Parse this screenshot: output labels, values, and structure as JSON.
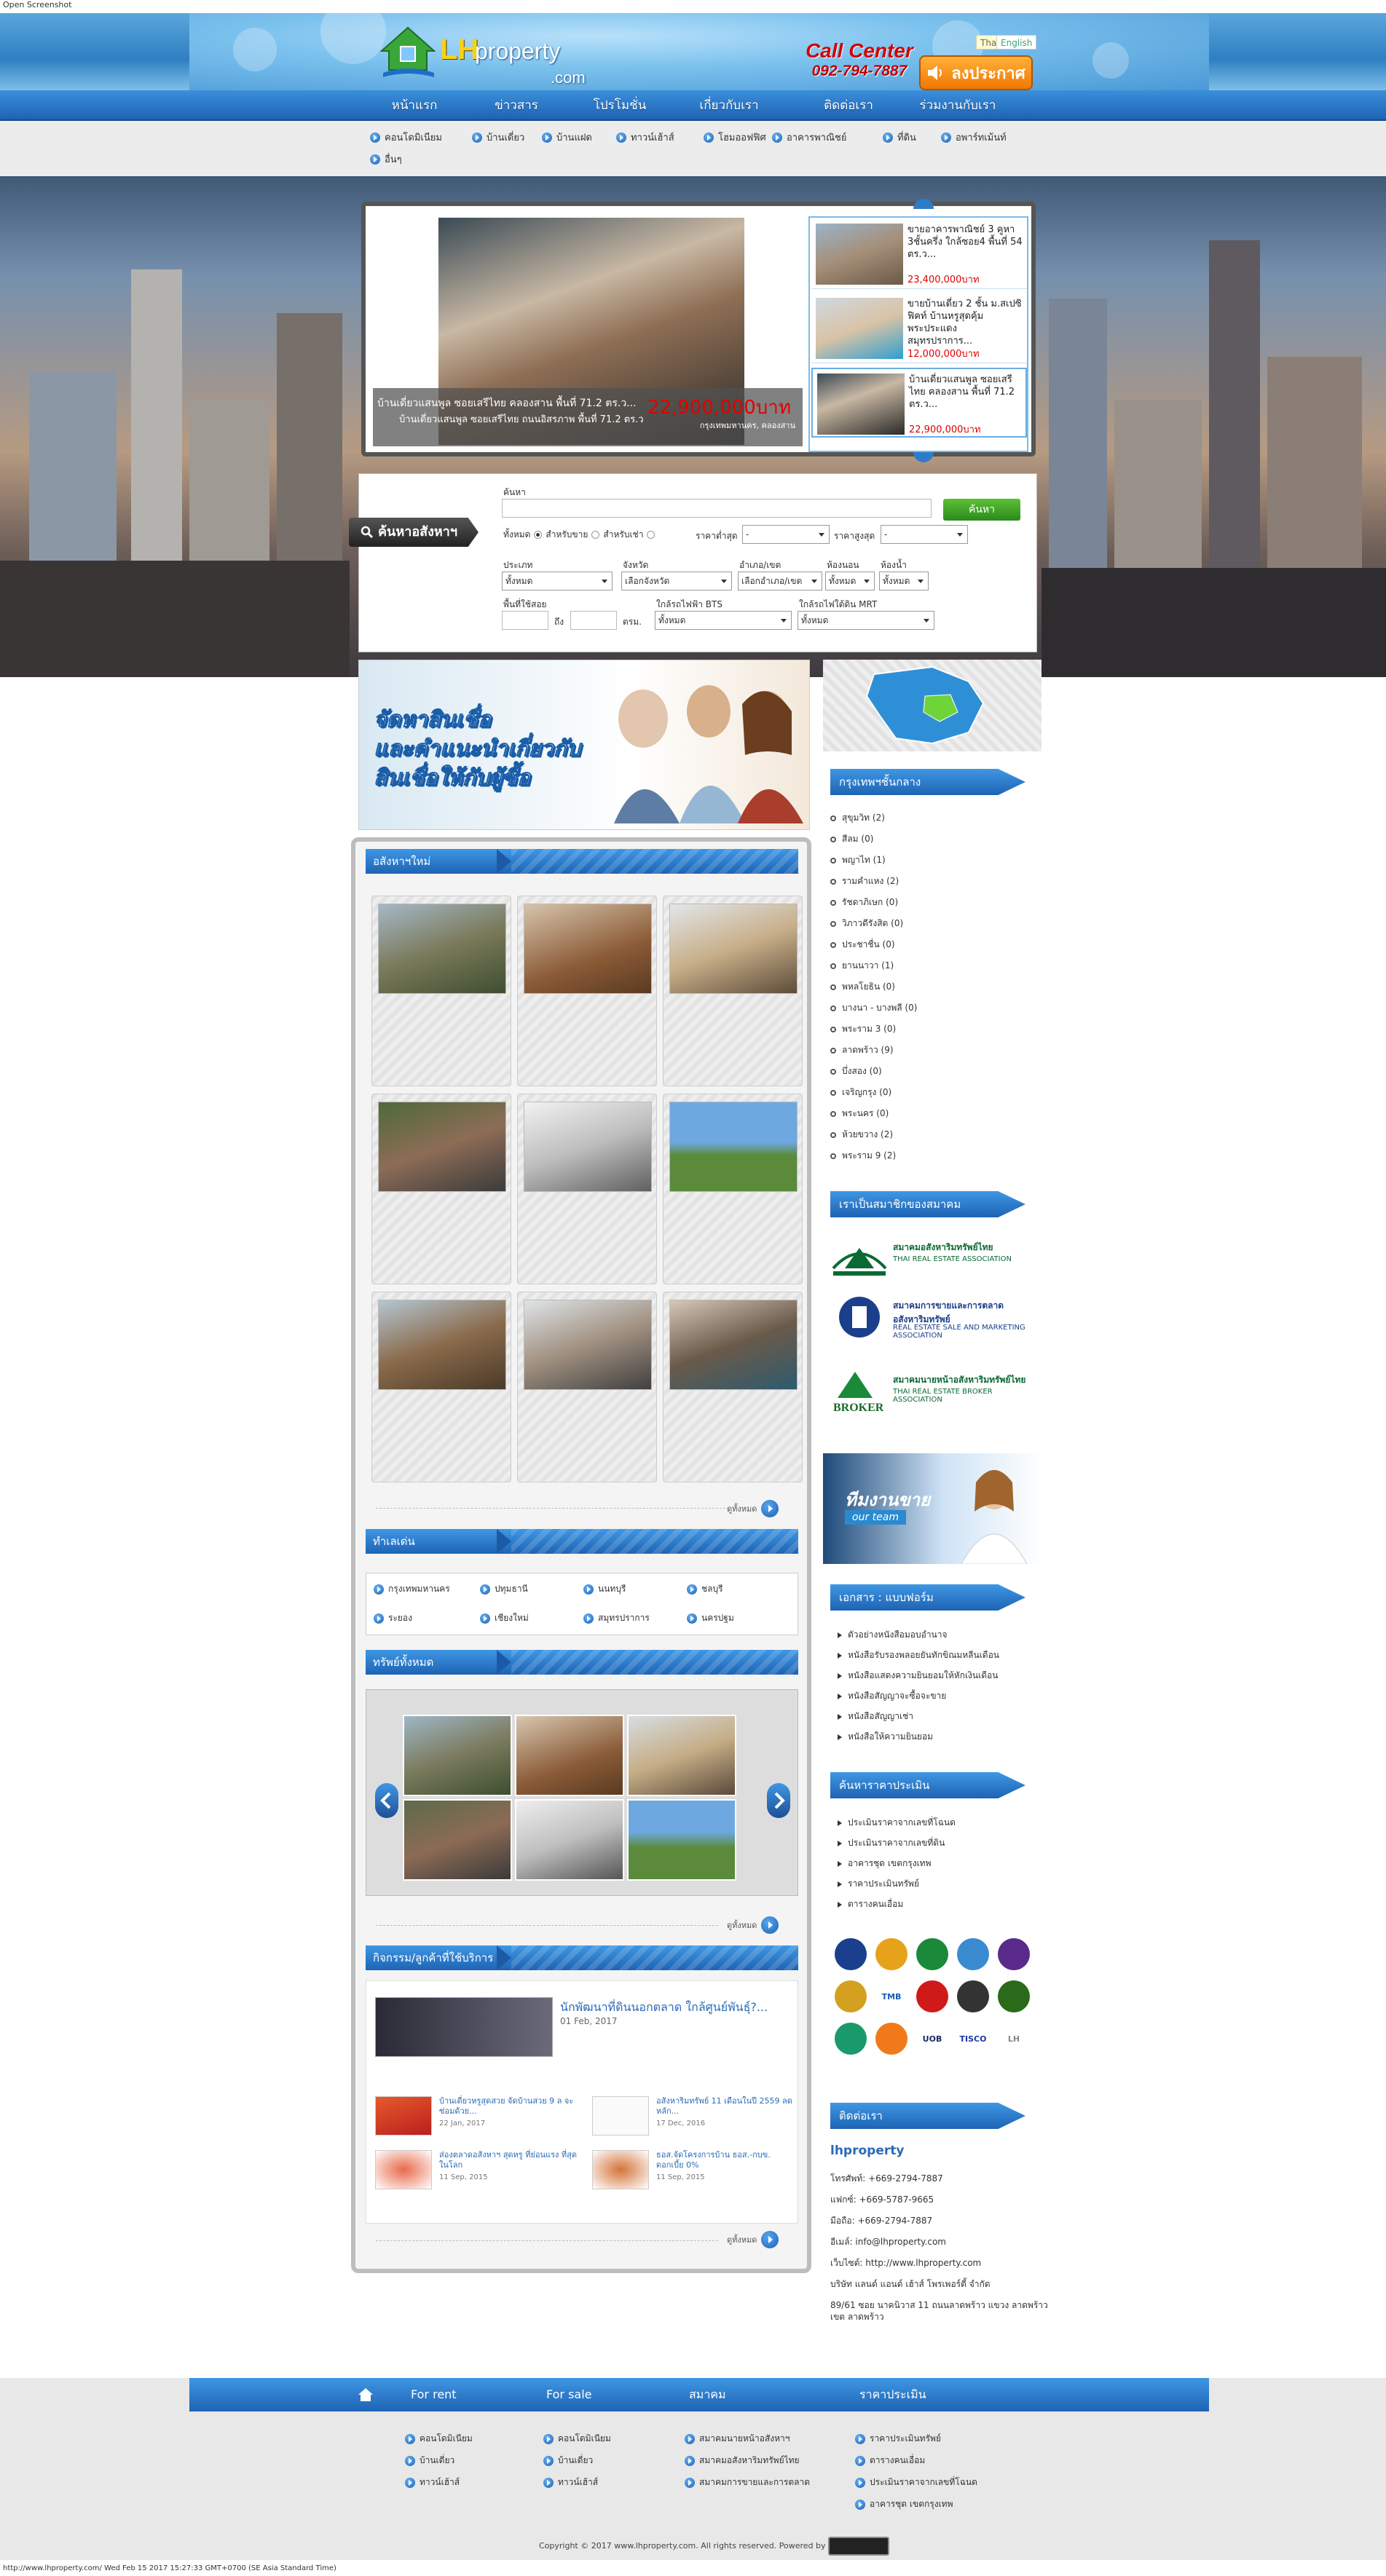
{
  "window": {
    "title": "Open Screenshot",
    "status": "http://www.lhproperty.com/ Wed Feb 15 2017 15:27:33 GMT+0700 (SE Asia Standard Time)"
  },
  "header": {
    "logo_lh": "LH",
    "logo_property": "property",
    "logo_com": ".com",
    "call_center": "Call Center",
    "phone": "092-794-7887",
    "announce": "ลงประกาศ",
    "lang_thai": "Thai",
    "lang_english": "English"
  },
  "nav": [
    "หน้าแรก",
    "ข่าวสาร",
    "โปรโมชั่น",
    "เกี่ยวกับเรา",
    "ติดต่อเรา",
    "ร่วมงานกับเรา"
  ],
  "subnav": [
    "คอนโดมิเนียม",
    "บ้านเดี่ยว",
    "บ้านแฝด",
    "ทาวน์เฮ้าส์",
    "โฮมออฟฟิศ",
    "อาคารพาณิชย์",
    "ที่ดิน",
    "อพาร์ทเม้นท์",
    "อื่นๆ"
  ],
  "slider": {
    "main_title": "บ้านเดี่ยวแสนพูล ซอยเสรีไทย คลองสาน พื้นที่ 71.2 ตร.ว...",
    "main_subtitle": "บ้านเดี่ยวแสนพูล ซอยเสรีไทย ถนนอิสรภาพ พื้นที่ 71.2 ตร.ว",
    "main_price": "22,900,000บาท",
    "main_location": "กรุงเทพมหานคร, คลองสาน",
    "items": [
      {
        "title": "ขายอาคารพาณิชย์ 3 คูหา 3ชั้นครึ่ง ใกล้ซอย4 พื้นที่ 54 ตร.ว...",
        "price": "23,400,000บาท"
      },
      {
        "title": "ขายบ้านเดี่ยว 2 ชั้น ม.สเปซิฟิคท์ บ้านหรูสุดคุ้ม พระประแดง สมุทรปราการ...",
        "price": "12,000,000บาท"
      },
      {
        "title": "บ้านเดี่ยวแสนพูล ซอยเสรีไทย คลองสาน พื้นที่ 71.2 ตร.ว...",
        "price": "22,900,000บาท"
      }
    ]
  },
  "search": {
    "tag": "ค้นหาอสังหาฯ",
    "keyword_label": "ค้นหา",
    "button": "ค้นหา",
    "type_label": "ประเภท",
    "type_options": [
      "ทั้งหมด",
      "สำหรับขาย",
      "สำหรับเช่า"
    ],
    "price_min_label": "ราคาต่ำสุด",
    "price_max_label": "ราคาสูงสุด",
    "price_min_value": "-",
    "price_max_value": "-",
    "category_label": "ประเภท",
    "category_value": "ทั้งหมด",
    "province_label": "จังหวัด",
    "province_value": "เลือกจังหวัด",
    "district_label": "อำเภอ/เขต",
    "district_value": "เลือกอำเภอ/เขต",
    "bedroom_label": "ห้องนอน",
    "bedroom_value": "ทั้งหมด",
    "bathroom_label": "ห้องน้ำ",
    "bathroom_value": "ทั้งหมด",
    "area_label": "พื้นที่ใช้สอย",
    "area_to": "ถึง",
    "area_unit": "ตรม.",
    "bts_label": "ใกล้รถไฟฟ้า BTS",
    "bts_value": "ทั้งหมด",
    "mrt_label": "ใกล้รถไฟใต้ดิน MRT",
    "mrt_value": "ทั้งหมด"
  },
  "banner": {
    "line1": "จัดหาสินเชื่อ",
    "line2": "และคำแนะนำเกี่ยวกับ",
    "line3": "สินเชื่อให้กับผู้ซื้อ"
  },
  "sections": {
    "new_property": "อสังหาฯใหม่",
    "popular": "ทำเลเด่น",
    "all_property": "ทรัพย์ทั้งหมด",
    "activity": "กิจกรรม/ลูกค้าที่ใช้บริการ",
    "see_all": "ดูทั้งหมด"
  },
  "provinces": [
    "กรุงเทพมหานคร",
    "ปทุมธานี",
    "นนทบุรี",
    "ชลบุรี",
    "ระยอง",
    "เชียงใหม่",
    "สมุทรปราการ",
    "นครปฐม"
  ],
  "activity": {
    "main_title": "นักพัฒนาที่ดินนอกตลาด ใกล้ศูนย์พันธุ์?...",
    "main_date": "01 Feb, 2017",
    "items": [
      {
        "title": "บ้านเดี่ยวหรูสุดสวย จัดบ้านสวย 9 ล จะซ่อมด้วย...",
        "date": "22 Jan, 2017"
      },
      {
        "title": "อสังหาริมทรัพย์ 11 เดือนในปี 2559 ลดหลัก...",
        "date": "17 Dec, 2016"
      },
      {
        "title": "ส่องตลาดอสังหาฯ สุดหรู ที่ย่อนแรง ที่สุดในโลก",
        "date": "11 Sep, 2015"
      },
      {
        "title": "ธอส.จัดโครงการบ้าน ธอส.-กบข. ดอกเบี้ย 0%",
        "date": "11 Sep, 2015"
      }
    ]
  },
  "right": {
    "bkk_title": "กรุงเทพฯชั้นกลาง",
    "bkk_items": [
      "สุขุมวิท (2)",
      "สีลม (0)",
      "พญาไท (1)",
      "รามคำแหง (2)",
      "รัชดาภิเษก (0)",
      "วิภาวดีรังสิต (0)",
      "ประชาชื่น (0)",
      "ยานนาวา (1)",
      "พหลโยธิน (0)",
      "บางนา - บางพลี (0)",
      "พระราม 3 (0)",
      "ลาดพร้าว (9)",
      "บึ่งสอง (0)",
      "เจริญกรุง (0)",
      "พระนคร (0)",
      "ห้วยขวาง (2)",
      "พระราม 9 (2)"
    ],
    "member_title": "เราเป็นสมาชิกของสมาคม",
    "assoc": [
      {
        "name": "สมาคมอสังหาริมทรัพย์ไทย",
        "en": "THAI REAL ESTATE ASSOCIATION"
      },
      {
        "name": "สมาคมการขายและการตลาด อสังหาริมทรัพย์",
        "en": "REAL ESTATE SALE AND MARKETING ASSOCIATION"
      },
      {
        "name": "สมาคมนายหน้าอสังหาริมทรัพย์ไทย",
        "en": "THAI REAL ESTATE BROKER ASSOCIATION"
      }
    ],
    "team_label": "ทีมงานขาย",
    "team_sub": "our team",
    "docs_title": "เอกสาร : แบบฟอร์ม",
    "docs": [
      "ตัวอย่างหนังสือมอบอำนาจ",
      "หนังสือรับรองพลอยยันทักขิณมหลีนเดือน",
      "หนังสือแสดงความยินยอมให้หักเงินเดือน",
      "หนังสือสัญญาจะซื้อจะขาย",
      "หนังสือสัญญาเช่า",
      "หนังสือให้ความยินยอม"
    ],
    "price_title": "ค้นหาราคาประเมิน",
    "price_links": [
      "ประเมินราคาจากเลขที่โฉนด",
      "ประเมินราคาจากเลขที่ดิน",
      "อาคารชุด เขตกรุงเทพ",
      "ราคาประเมินทรัพย์",
      "ตารางคนเอื่อม"
    ],
    "contact_title": "ติดต่อเรา",
    "contact_name": "lhproperty",
    "contact_lines": [
      "โทรศัพท์: +669-2794-7887",
      "แฟกซ์: +669-5787-9665",
      "มือถือ: +669-2794-7887",
      "อีเมล์: info@lhproperty.com",
      "เว็บไซต์: http://www.lhproperty.com",
      "บริษัท แลนด์ แอนด์ เฮ้าส์ โพรเพอร์ตี้ จำกัด",
      "89/61 ซอย นาคนิวาส 11 ถนนลาดพร้าว แขวง ลาดพร้าว เขต ลาดพร้าว"
    ]
  },
  "banks": [
    "bank-icon-1",
    "bank-icon-2",
    "bank-icon-3",
    "bank-icon-4",
    "bank-icon-5",
    "bank-icon-6",
    "bank-icon-tmb",
    "bank-icon-8",
    "bank-icon-9",
    "bank-icon-10",
    "bank-icon-11",
    "bank-icon-12",
    "bank-icon-uob",
    "bank-icon-tisco",
    "bank-icon-lh"
  ],
  "bank_labels": {
    "tmb": "TMB",
    "uob": "UOB",
    "tisco": "TISCO",
    "lh": "LH"
  },
  "footer": {
    "bar": [
      "For rent",
      "For sale",
      "สมาคม",
      "ราคาประเมิน"
    ],
    "rent": [
      "คอนโดมิเนียม",
      "บ้านเดี่ยว",
      "ทาวน์เฮ้าส์"
    ],
    "sale": [
      "คอนโดมิเนียม",
      "บ้านเดี่ยว",
      "ทาวน์เฮ้าส์"
    ],
    "assoc": [
      "สมาคมนายหน้าอสังหาฯ",
      "สมาคมอสังหาริมทรัพย์ไทย",
      "สมาคมการขายและการตลาด"
    ],
    "price": [
      "ราคาประเมินทรัพย์",
      "ตารางคนเอื่อม",
      "ประเมินราคาจากเลขที่โฉนด",
      "อาคารชุด เขตกรุงเทพ"
    ],
    "copyright": "Copyright © 2017 www.lhproperty.com. All rights reserved. Powered by"
  },
  "colors": {
    "accent": "#1e63b4",
    "price": "#e10000",
    "brand_yellow": "#f6d21b"
  }
}
